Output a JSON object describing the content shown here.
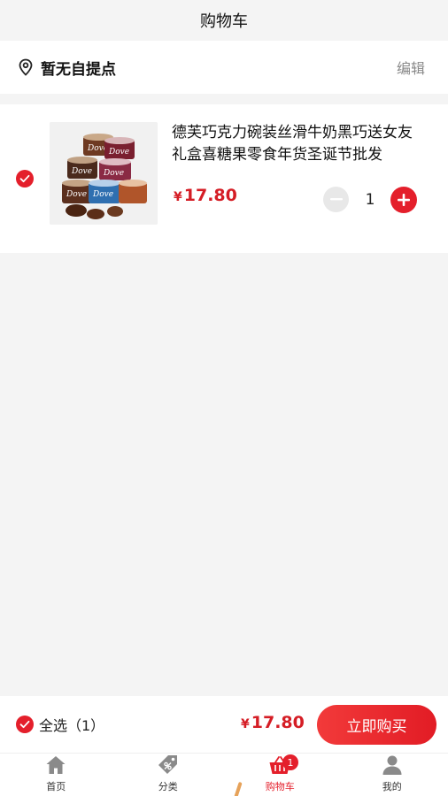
{
  "header": {
    "title": "购物车"
  },
  "pickup": {
    "label": "暂无自提点",
    "edit_label": "编辑"
  },
  "cart_item": {
    "name": "德芙巧克力碗装丝滑牛奶黑巧送女友礼盒喜糖果零食年货圣诞节批发",
    "currency": "¥",
    "price": "17.80",
    "quantity": "1",
    "selected": true,
    "image_logo_text": "Dove"
  },
  "checkout": {
    "select_all_label": "全选（1）",
    "currency": "¥",
    "total": "17.80",
    "buy_label": "立即购买"
  },
  "tabbar": {
    "tabs": [
      {
        "label": "首页",
        "icon": "home-icon"
      },
      {
        "label": "分类",
        "icon": "tag-icon"
      },
      {
        "label": "购物车",
        "icon": "basket-icon",
        "badge": "1",
        "active": true
      },
      {
        "label": "我的",
        "icon": "user-icon"
      }
    ]
  },
  "colors": {
    "accent": "#e41f2b",
    "price": "#d51d25",
    "background": "#f4f4f4"
  }
}
